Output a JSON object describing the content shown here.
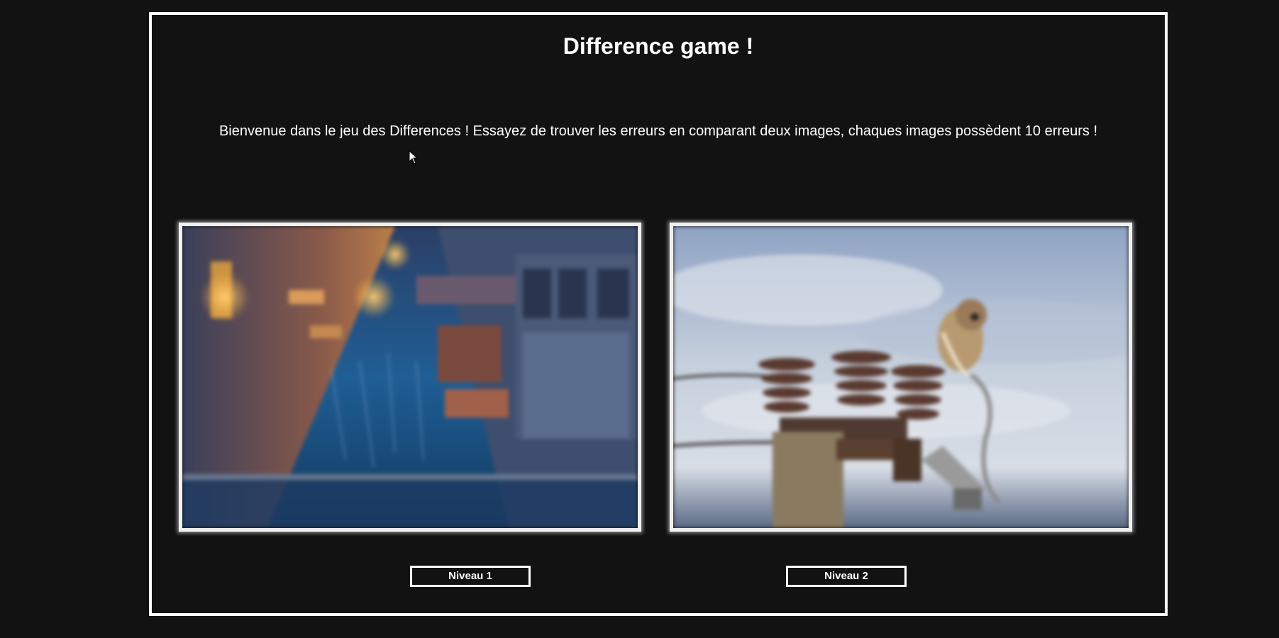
{
  "game": {
    "title": "Difference game !",
    "intro": "Bienvenue dans le jeu des Differences ! Essayez de trouver les erreurs en comparant deux images, chaques images possèdent 10 erreurs !"
  },
  "levels": [
    {
      "label": "Niveau 1",
      "image": "venice-canal-street-night"
    },
    {
      "label": "Niveau 2",
      "image": "owl-on-power-insulators"
    }
  ],
  "icons": {
    "cursor": "mouse-pointer-icon"
  },
  "colors": {
    "background": "#121212",
    "border": "#ffffff",
    "text": "#ffffff"
  }
}
